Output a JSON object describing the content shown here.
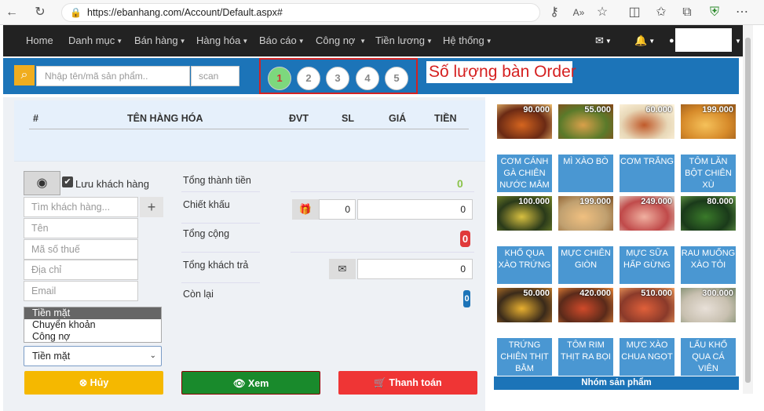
{
  "browser": {
    "url": "https://ebanhang.com/Account/Default.aspx#"
  },
  "nav": {
    "items": [
      "Home",
      "Danh mục",
      "Bán hàng",
      "Hàng hóa",
      "Báo cáo",
      "Công nợ",
      "Tiền lương",
      "Hệ thống"
    ]
  },
  "search": {
    "placeholder": "Nhập tên/mã sản phẩm..",
    "scan_label": "scan"
  },
  "orders": {
    "tables": [
      "1",
      "2",
      "3",
      "4",
      "5"
    ],
    "active": "1",
    "annotation": "Số lượng bàn Order"
  },
  "cart": {
    "columns": [
      "#",
      "TÊN HÀNG HÓA",
      "ĐVT",
      "SL",
      "GIÁ",
      "TIỀN"
    ]
  },
  "customer": {
    "save_label": "Lưu khách hàng",
    "search_placeholder": "Tìm khách hàng...",
    "name_placeholder": "Tên",
    "tax_placeholder": "Mã số thuế",
    "address_placeholder": "Địa chỉ",
    "email_placeholder": "Email",
    "payment_options": [
      "Tiền mặt",
      "Chuyển khoản",
      "Công nợ"
    ],
    "payment_selected": "Tiền mặt"
  },
  "totals": {
    "subtotal_label": "Tổng thành tiền",
    "subtotal_value": "0",
    "discount_label": "Chiết khấu",
    "discount_percent": "0",
    "discount_amount": "0",
    "total_label": "Tổng cộng",
    "total_value": "0",
    "paid_label": "Tổng khách trả",
    "paid_value": "0",
    "remain_label": "Còn lại",
    "remain_value": "0"
  },
  "actions": {
    "cancel": "Hủy",
    "view": "Xem",
    "pay": "Thanh toán"
  },
  "products": [
    {
      "price": "90.000",
      "name": "CƠM CÁNH GÀ CHIÊN NƯỚC MẮM"
    },
    {
      "price": "55.000",
      "name": "MÌ XÀO BÒ"
    },
    {
      "price": "60.000",
      "name": "CƠM TRẮNG"
    },
    {
      "price": "199.000",
      "name": "TÔM LĂN BỘT CHIÊN XÙ"
    },
    {
      "price": "100.000",
      "name": "KHỔ QUA XÀO TRỨNG"
    },
    {
      "price": "199.000",
      "name": "MỰC CHIÊN GIÒN"
    },
    {
      "price": "249.000",
      "name": "MỰC SỮA HẤP GỪNG"
    },
    {
      "price": "80.000",
      "name": "RAU MUỐNG XÀO TỎI"
    },
    {
      "price": "50.000",
      "name": "TRỨNG CHIÊN THỊT BẰM"
    },
    {
      "price": "420.000",
      "name": "TÔM RIM THỊT RA BỌI"
    },
    {
      "price": "510.000",
      "name": "MỰC XÀO CHUA NGỌT"
    },
    {
      "price": "300.000",
      "name": "LẨU KHỔ QUA CÁ VIÊN"
    }
  ],
  "product_group_label": "Nhóm sản phẩm",
  "colors": {
    "primary": "#1c74b8",
    "product_tile": "#4a97d2",
    "cancel": "#f5b800",
    "view": "#198a2c",
    "pay": "#ef3535",
    "annotation": "#d52020"
  }
}
